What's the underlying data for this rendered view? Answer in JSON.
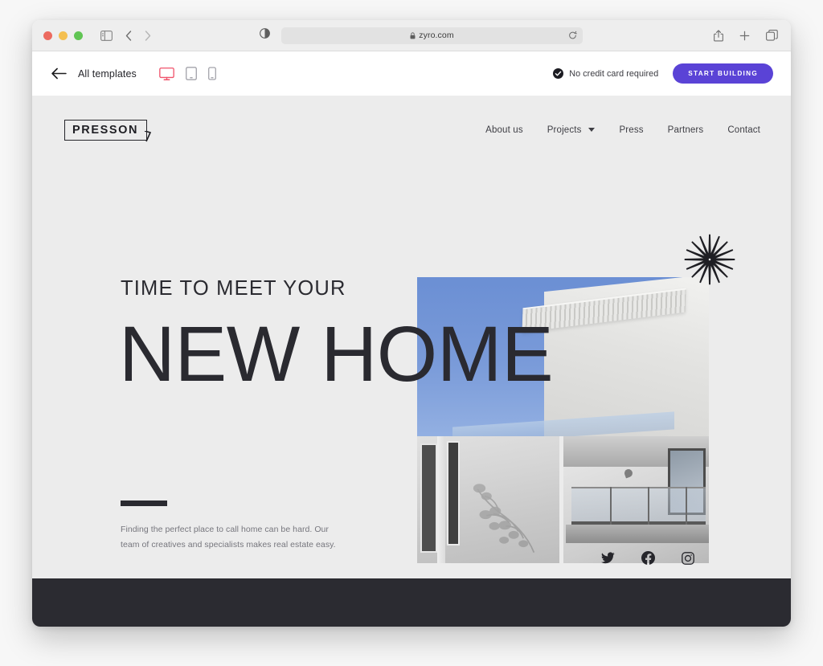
{
  "browser": {
    "traffic_lights": [
      "close",
      "minimize",
      "zoom"
    ],
    "sidebar_icon": "sidebar-icon",
    "back_icon": "chevron-left-icon",
    "forward_icon": "chevron-right-icon",
    "contrast_icon": "contrast-icon",
    "url": "zyro.com",
    "lock_icon": "lock-icon",
    "reload_icon": "reload-icon",
    "share_icon": "share-icon",
    "new_tab_icon": "plus-icon",
    "tabs_icon": "tabs-icon"
  },
  "editor": {
    "back_label": "All templates",
    "back_icon": "arrow-left-icon",
    "devices": [
      {
        "name": "desktop",
        "icon": "desktop-icon",
        "active": true
      },
      {
        "name": "tablet",
        "icon": "tablet-icon",
        "active": false
      },
      {
        "name": "mobile",
        "icon": "mobile-icon",
        "active": false
      }
    ],
    "no_credit_card": "No credit card required",
    "check_icon": "check-circle-icon",
    "cta_label": "START BUILDING",
    "cta_color": "#5a43d6"
  },
  "site": {
    "logo_text": "PRESSON",
    "nav": [
      {
        "label": "About us",
        "has_dropdown": false
      },
      {
        "label": "Projects",
        "has_dropdown": true
      },
      {
        "label": "Press",
        "has_dropdown": false
      },
      {
        "label": "Partners",
        "has_dropdown": false
      },
      {
        "label": "Contact",
        "has_dropdown": false
      }
    ],
    "hero": {
      "kicker": "TIME TO MEET YOUR",
      "headline": "NEW HOME",
      "blurb": "Finding the perfect place to call home can be hard. Our team of creatives and specialists makes real estate easy.",
      "image_alt": "modern-house-photo",
      "decoration": "starburst-icon"
    },
    "socials": [
      {
        "name": "twitter",
        "icon": "twitter-icon"
      },
      {
        "name": "facebook",
        "icon": "facebook-icon"
      },
      {
        "name": "instagram",
        "icon": "instagram-icon"
      }
    ],
    "colors": {
      "page_bg": "#ececec",
      "text_dark": "#2a2a30",
      "muted": "#76767d",
      "footer": "#2b2b31",
      "accent_device": "#f0536b"
    }
  }
}
